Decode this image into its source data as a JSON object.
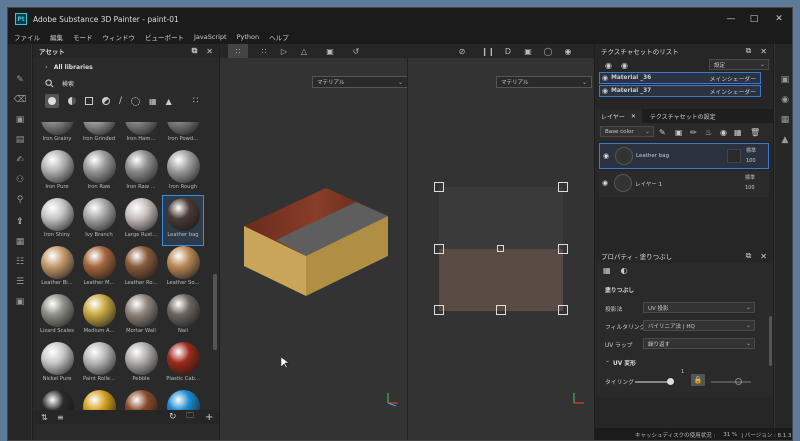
{
  "app": {
    "title": "Adobe Substance 3D Painter - paint-01",
    "logo": "Pt"
  },
  "menu": [
    "ファイル",
    "編集",
    "モード",
    "ウィンドウ",
    "ビューポート",
    "JavaScript",
    "Python",
    "ヘルプ"
  ],
  "assets": {
    "title": "アセット",
    "breadcrumb": "All libraries",
    "search_placeholder": "検索",
    "items": [
      {
        "label": "Iron Grainy",
        "color": "#8a8a8a"
      },
      {
        "label": "Iron Grinded",
        "color": "#9a9a9a"
      },
      {
        "label": "Iron Ham...",
        "color": "#858585"
      },
      {
        "label": "Iron Powd...",
        "color": "#7e7e7e"
      },
      {
        "label": "Iron Pure",
        "color": "#b5b5b5"
      },
      {
        "label": "Iron Raw",
        "color": "#9b9b9b"
      },
      {
        "label": "Iron Raw ...",
        "color": "#8f8f8f"
      },
      {
        "label": "Iron Rough",
        "color": "#a0a0a0"
      },
      {
        "label": "Iron Shiny",
        "color": "#c6c6c6"
      },
      {
        "label": "Ivy Branch",
        "color": "#a8a8a8"
      },
      {
        "label": "Large Rust...",
        "color": "#c9c0bd"
      },
      {
        "label": "Leather bag",
        "color": "#4a3a36"
      },
      {
        "label": "Leather Bi...",
        "color": "#c49a6c"
      },
      {
        "label": "Leather M...",
        "color": "#a4663d"
      },
      {
        "label": "Leather Ro...",
        "color": "#8a5a3b"
      },
      {
        "label": "Leather So...",
        "color": "#b98859"
      },
      {
        "label": "Lizard Scales",
        "color": "#8f8f88"
      },
      {
        "label": "Medium A...",
        "color": "#c9a840"
      },
      {
        "label": "Mortar Wall",
        "color": "#8d837a"
      },
      {
        "label": "Nail",
        "color": "#6a6560"
      },
      {
        "label": "Nickel Pure",
        "color": "#c9c9c9"
      },
      {
        "label": "Paint Rolle...",
        "color": "#b8b8b8"
      },
      {
        "label": "Pebble",
        "color": "#b0aeaa"
      },
      {
        "label": "Plastic Cab...",
        "color": "#9a2a1a"
      },
      {
        "label": "",
        "color": "#2a2a2a"
      },
      {
        "label": "",
        "color": "#d4a020"
      },
      {
        "label": "",
        "color": "#8a4a2a"
      },
      {
        "label": "",
        "color": "#1a8ad0"
      }
    ]
  },
  "viewport": {
    "left_dropdown": "マテリアル",
    "right_dropdown": "マテリアル"
  },
  "texture_sets": {
    "title": "テクスチャセットのリスト",
    "settings_label": "設定",
    "items": [
      {
        "name": "Material _36",
        "shader": "メインシェーダー"
      },
      {
        "name": "Material _37",
        "shader": "メインシェーダー"
      }
    ]
  },
  "layers": {
    "tab_layers": "レイヤー",
    "tab_settings": "テクスチャセットの設定",
    "channel_dropdown": "Base color",
    "items": [
      {
        "name": "Leather bag",
        "blend": "標準",
        "opacity": "100"
      },
      {
        "name": "レイヤー 1",
        "blend": "標準",
        "opacity": "100"
      }
    ]
  },
  "properties": {
    "title": "プロパティ - 塗りつぶし",
    "section": "塗りつぶし",
    "fields": [
      {
        "label": "投影法",
        "value": "UV 投影"
      },
      {
        "label": "フィルタリング",
        "value": "バイリニア法 | HQ"
      },
      {
        "label": "UV ラップ",
        "value": "繰り返す"
      }
    ],
    "uv_section": "UV 変形",
    "tiling_label": "タイリング",
    "tiling_value": "1"
  },
  "status": {
    "text": "キャッシュディスクの使用状況 :",
    "percent": "31 %",
    "version": "| バージョン : 8.1.3"
  }
}
